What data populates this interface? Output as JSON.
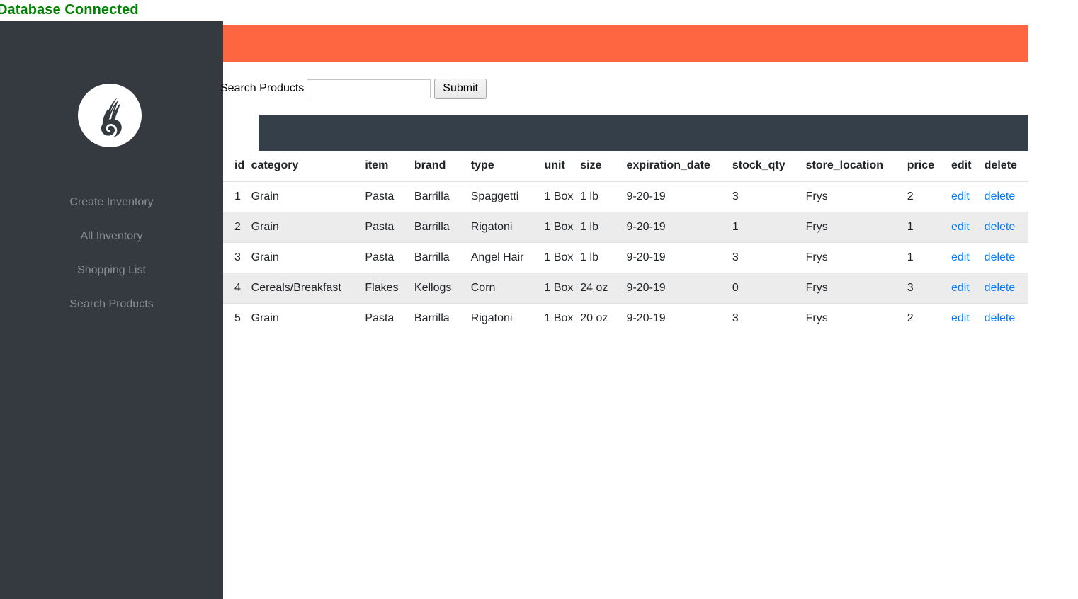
{
  "status": {
    "text": "Database Connected",
    "color": "#018001"
  },
  "theme": {
    "sidebar_bg": "#343a40",
    "accent_orange": "#fd6640",
    "table_head_bg": "#343f49",
    "link_blue": "#007bff",
    "stripe": "#ececec"
  },
  "sidebar": {
    "logo_icon": "air-nomad-flame-icon",
    "items": [
      {
        "label": "Create Inventory",
        "name": "sidebar-item-create-inventory"
      },
      {
        "label": "All Inventory",
        "name": "sidebar-item-all-inventory"
      },
      {
        "label": "Shopping List",
        "name": "sidebar-item-shopping-list"
      },
      {
        "label": "Search Products",
        "name": "sidebar-item-search-products"
      }
    ]
  },
  "search": {
    "label": "Search Products",
    "value": "",
    "placeholder": "",
    "submit_label": "Submit"
  },
  "table": {
    "columns": [
      "id",
      "category",
      "item",
      "brand",
      "type",
      "unit",
      "size",
      "expiration_date",
      "stock_qty",
      "store_location",
      "price",
      "edit",
      "delete"
    ],
    "rows": [
      {
        "id": "1",
        "category": "Grain",
        "item": "Pasta",
        "brand": "Barrilla",
        "type": "Spaggetti",
        "unit": "1 Box",
        "size": "1 lb",
        "expiration_date": "9-20-19",
        "stock_qty": "3",
        "store_location": "Frys",
        "price": "2",
        "edit": "edit",
        "delete": "delete"
      },
      {
        "id": "2",
        "category": "Grain",
        "item": "Pasta",
        "brand": "Barrilla",
        "type": "Rigatoni",
        "unit": "1 Box",
        "size": "1 lb",
        "expiration_date": "9-20-19",
        "stock_qty": "1",
        "store_location": "Frys",
        "price": "1",
        "edit": "edit",
        "delete": "delete"
      },
      {
        "id": "3",
        "category": "Grain",
        "item": "Pasta",
        "brand": "Barrilla",
        "type": "Angel Hair",
        "unit": "1 Box",
        "size": "1 lb",
        "expiration_date": "9-20-19",
        "stock_qty": "3",
        "store_location": "Frys",
        "price": "1",
        "edit": "edit",
        "delete": "delete"
      },
      {
        "id": "4",
        "category": "Cereals/Breakfast",
        "item": "Flakes",
        "brand": "Kellogs",
        "type": "Corn",
        "unit": "1 Box",
        "size": "24 oz",
        "expiration_date": "9-20-19",
        "stock_qty": "0",
        "store_location": "Frys",
        "price": "3",
        "edit": "edit",
        "delete": "delete"
      },
      {
        "id": "5",
        "category": "Grain",
        "item": "Pasta",
        "brand": "Barrilla",
        "type": "Rigatoni",
        "unit": "1 Box",
        "size": "20 oz",
        "expiration_date": "9-20-19",
        "stock_qty": "3",
        "store_location": "Frys",
        "price": "2",
        "edit": "edit",
        "delete": "delete"
      }
    ]
  }
}
